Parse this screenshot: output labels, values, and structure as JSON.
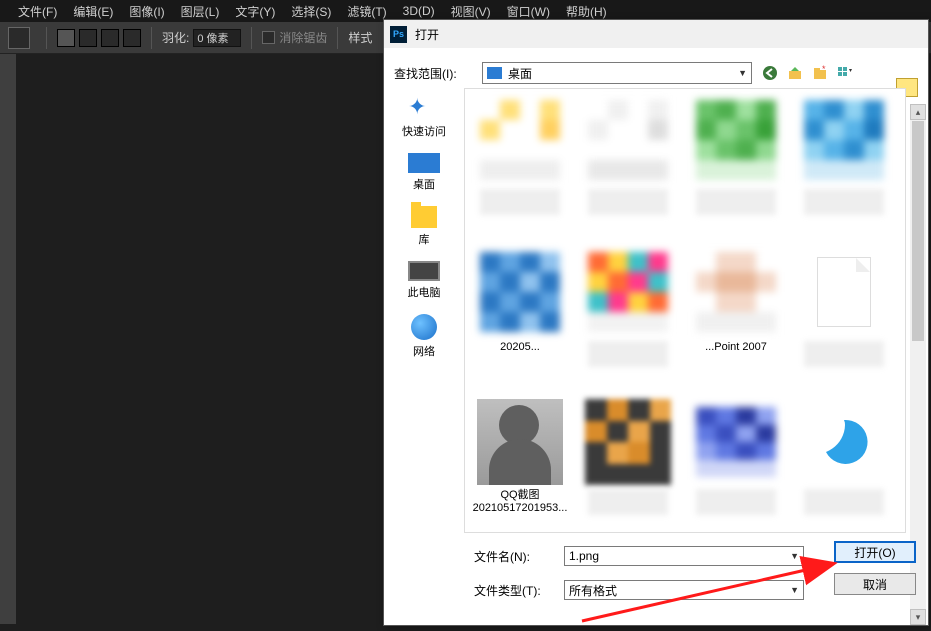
{
  "menu": {
    "file": "文件(F)",
    "edit": "编辑(E)",
    "image": "图像(I)",
    "layer": "图层(L)",
    "type": "文字(Y)",
    "select": "选择(S)",
    "filter": "滤镜(T)",
    "threeD": "3D(D)",
    "view": "视图(V)",
    "window": "窗口(W)",
    "help": "帮助(H)"
  },
  "optbar": {
    "feather_label": "羽化:",
    "feather_value": "0 像素",
    "anti_alias": "消除锯齿",
    "style_label": "样式"
  },
  "dialog": {
    "title": "打开",
    "range_label": "查找范围(I):",
    "range_value": "桌面",
    "places": {
      "quick": "快速访问",
      "desktop": "桌面",
      "libraries": "库",
      "thispc": "此电脑",
      "network": "网络"
    },
    "tiles": {
      "t6_cap": "20205...",
      "t8_cap": "...Point 2007",
      "t9_cap": "QQ截图20210517201953..."
    },
    "filename_label": "文件名(N):",
    "filename_value": "1.png",
    "filetype_label": "文件类型(T):",
    "filetype_value": "所有格式",
    "open_btn": "打开(O)",
    "cancel_btn": "取消"
  }
}
